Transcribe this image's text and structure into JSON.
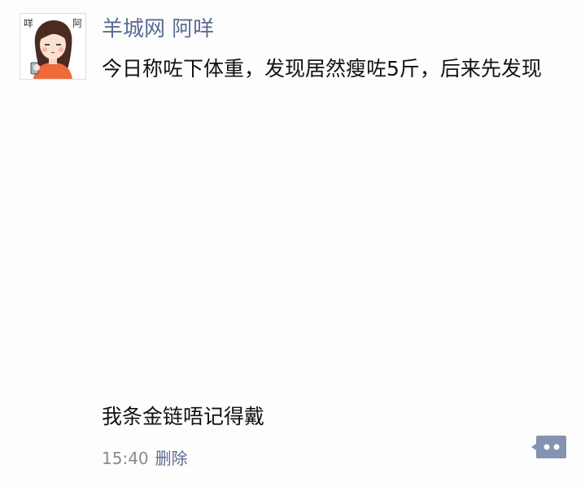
{
  "post": {
    "author": "羊城网 阿咩",
    "avatar_icon": "cartoon-girl-avatar",
    "avatar_text_left": "咩",
    "avatar_text_right": "阿",
    "text_line1": "今日称咗下体重，发现居然瘦咗5斤，后来先发现",
    "text_line2": "我条金链唔记得戴",
    "time": "15:40",
    "delete_label": "删除",
    "comment_icon": "comment-bubble-icon"
  },
  "colors": {
    "author": "#5b6b94",
    "text": "#111111",
    "meta": "#8a8a8a",
    "background": "#fdfdfd",
    "comment_button": "#8393b1"
  }
}
